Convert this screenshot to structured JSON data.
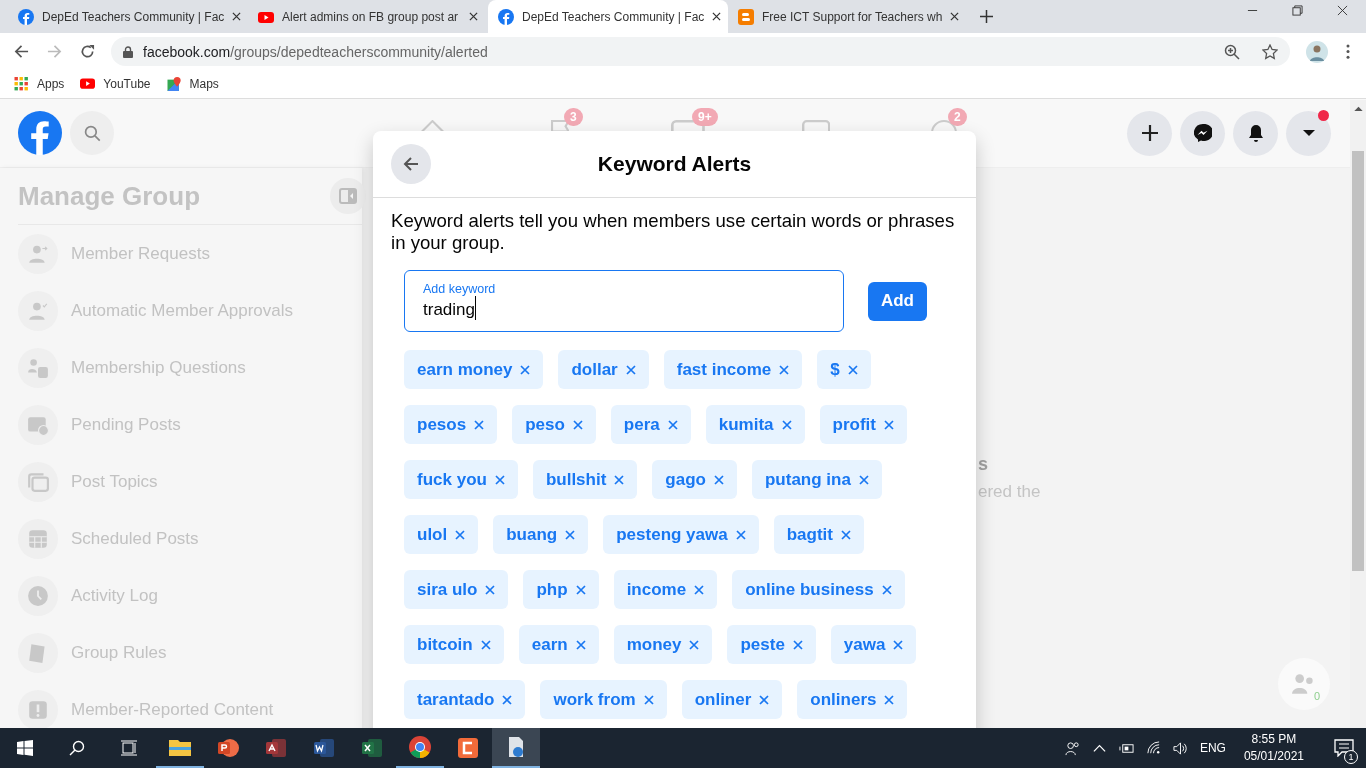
{
  "browser": {
    "tabs": [
      {
        "title": "DepEd Teachers Community | Fac",
        "kind": "facebook",
        "selected": false
      },
      {
        "title": "Alert admins on FB group post ar",
        "kind": "youtube",
        "selected": false
      },
      {
        "title": "DepEd Teachers Community | Fac",
        "kind": "facebook",
        "selected": true
      },
      {
        "title": "Free ICT Support for Teachers wh",
        "kind": "blogger",
        "selected": false
      }
    ],
    "url_host": "facebook.com",
    "url_path": "/groups/depedteacherscommunity/alerted",
    "bookmarks": [
      {
        "label": "Apps",
        "kind": "apps"
      },
      {
        "label": "YouTube",
        "kind": "youtube"
      },
      {
        "label": "Maps",
        "kind": "maps"
      }
    ]
  },
  "header": {
    "nav": [
      {
        "kind": "home"
      },
      {
        "kind": "flag",
        "badge": "3"
      },
      {
        "kind": "video",
        "badge": "9+"
      },
      {
        "kind": "store"
      },
      {
        "kind": "groups",
        "badge": "2"
      }
    ],
    "actions": [
      {
        "kind": "plus"
      },
      {
        "kind": "messenger"
      },
      {
        "kind": "bell"
      },
      {
        "kind": "caret",
        "dot": true
      }
    ]
  },
  "sidebar": {
    "title": "Manage Group",
    "items": [
      {
        "label": "Member Requests",
        "kind": "person-arrow"
      },
      {
        "label": "Automatic Member Approvals",
        "kind": "person-check"
      },
      {
        "label": "Membership Questions",
        "kind": "person-form"
      },
      {
        "label": "Pending Posts",
        "kind": "post-clock"
      },
      {
        "label": "Post Topics",
        "kind": "topics"
      },
      {
        "label": "Scheduled Posts",
        "kind": "calendar"
      },
      {
        "label": "Activity Log",
        "kind": "clock"
      },
      {
        "label": "Group Rules",
        "kind": "book"
      },
      {
        "label": "Member-Reported Content",
        "kind": "alert"
      }
    ]
  },
  "background_text": [
    "s",
    "ered the"
  ],
  "contacts_count": "0",
  "modal": {
    "title": "Keyword Alerts",
    "description": "Keyword alerts tell you when members use certain words or phrases in your group.",
    "field": {
      "label": "Add keyword",
      "value": "trading"
    },
    "add_button": "Add",
    "keywords": [
      "earn money",
      "dollar",
      "fast income",
      "$",
      "pesos",
      "peso",
      "pera",
      "kumita",
      "profit",
      "fuck you",
      "bullshit",
      "gago",
      "putang ina",
      "ulol",
      "buang",
      "pesteng yawa",
      "bagtit",
      "sira ulo",
      "php",
      "income",
      "online business",
      "bitcoin",
      "earn",
      "money",
      "peste",
      "yawa",
      "tarantado",
      "work from",
      "onliner",
      "onliners"
    ]
  },
  "taskbar": {
    "apps": [
      {
        "kind": "explorer",
        "running": true,
        "selected": false
      },
      {
        "kind": "powerpoint",
        "running": false,
        "selected": false
      },
      {
        "kind": "access",
        "running": false,
        "selected": false
      },
      {
        "kind": "word",
        "running": false,
        "selected": false
      },
      {
        "kind": "excel",
        "running": false,
        "selected": false
      },
      {
        "kind": "chrome",
        "running": true,
        "selected": false
      },
      {
        "kind": "recorder",
        "running": false,
        "selected": false
      },
      {
        "kind": "document",
        "running": true,
        "selected": true
      }
    ],
    "language": "ENG",
    "time": "8:55 PM",
    "date": "05/01/2021",
    "notifications": "1"
  }
}
